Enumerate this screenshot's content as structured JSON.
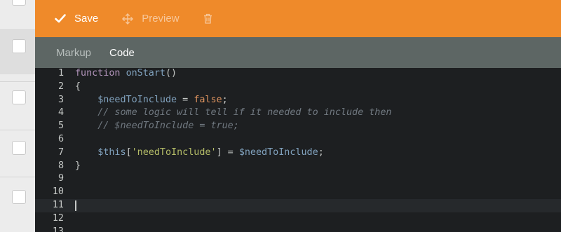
{
  "toolbar": {
    "save_label": "Save",
    "preview_label": "Preview",
    "icons": [
      "check-icon",
      "move-icon",
      "trash-icon"
    ],
    "accent": "#ef8a2a"
  },
  "tabs": [
    {
      "label": "Markup",
      "active": false
    },
    {
      "label": "Code",
      "active": true
    }
  ],
  "editor": {
    "active_line": 11,
    "lines": [
      {
        "n": "1",
        "segments": [
          {
            "t": "function",
            "c": "kw"
          },
          {
            "t": " ",
            "c": "plain"
          },
          {
            "t": "onStart",
            "c": "fn"
          },
          {
            "t": "()",
            "c": "plain"
          }
        ]
      },
      {
        "n": "2",
        "segments": [
          {
            "t": "{",
            "c": "plain"
          }
        ]
      },
      {
        "n": "3",
        "segments": [
          {
            "t": "    ",
            "c": "plain"
          },
          {
            "t": "$needToInclude",
            "c": "var"
          },
          {
            "t": " = ",
            "c": "op"
          },
          {
            "t": "false",
            "c": "bool"
          },
          {
            "t": ";",
            "c": "plain"
          }
        ]
      },
      {
        "n": "4",
        "segments": [
          {
            "t": "    ",
            "c": "plain"
          },
          {
            "t": "// some logic will tell if it needed to include then",
            "c": "cmt"
          }
        ]
      },
      {
        "n": "5",
        "segments": [
          {
            "t": "    ",
            "c": "plain"
          },
          {
            "t": "// $needToInclude = true;",
            "c": "cmt"
          }
        ]
      },
      {
        "n": "6",
        "segments": []
      },
      {
        "n": "7",
        "segments": [
          {
            "t": "    ",
            "c": "plain"
          },
          {
            "t": "$this",
            "c": "var"
          },
          {
            "t": "[",
            "c": "plain"
          },
          {
            "t": "'needToInclude'",
            "c": "str"
          },
          {
            "t": "] = ",
            "c": "plain"
          },
          {
            "t": "$needToInclude",
            "c": "var"
          },
          {
            "t": ";",
            "c": "plain"
          }
        ]
      },
      {
        "n": "8",
        "segments": [
          {
            "t": "}",
            "c": "plain"
          }
        ]
      },
      {
        "n": "9",
        "segments": []
      },
      {
        "n": "10",
        "segments": []
      },
      {
        "n": "11",
        "segments": []
      },
      {
        "n": "12",
        "segments": []
      },
      {
        "n": "13",
        "segments": []
      }
    ]
  }
}
